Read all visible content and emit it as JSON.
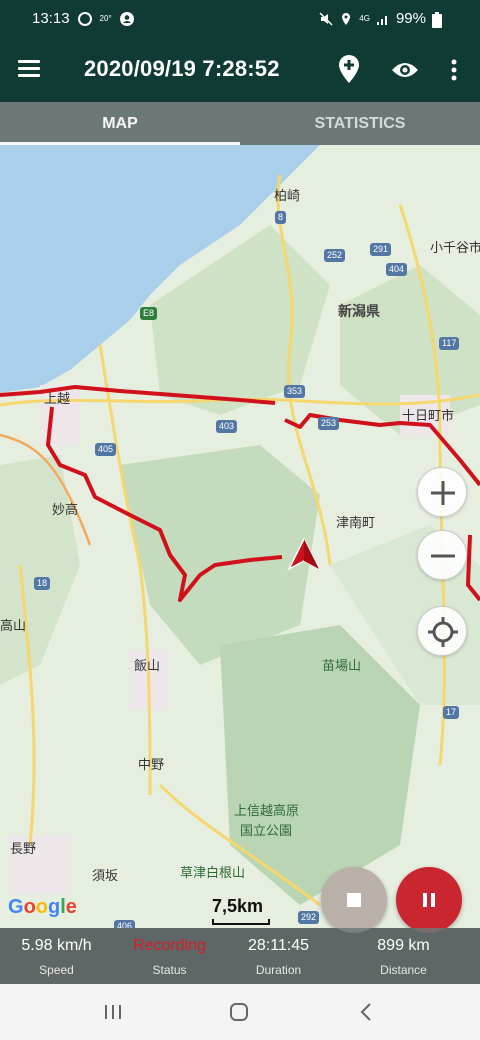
{
  "status_bar": {
    "time": "13:13",
    "battery": "99%",
    "network": "4G",
    "weather_temp": "20°"
  },
  "app_bar": {
    "title": "2020/09/19 7:28:52",
    "icons": [
      "menu-icon",
      "add-marker-icon",
      "visibility-icon",
      "overflow-icon"
    ]
  },
  "tabs": [
    {
      "label": "MAP",
      "selected": true
    },
    {
      "label": "STATISTICS",
      "selected": false
    }
  ],
  "map": {
    "places": [
      "柏崎",
      "小千谷市",
      "新潟県",
      "上越",
      "十日町市",
      "妙高",
      "津南町",
      "高山",
      "飯山",
      "苗場山",
      "中野",
      "上信越高原",
      "国立公園",
      "長野",
      "須坂",
      "草津白根山"
    ],
    "road_numbers": [
      "8",
      "252",
      "291",
      "404",
      "E8",
      "117",
      "353",
      "403",
      "253",
      "405",
      "18",
      "17",
      "406",
      "292"
    ],
    "scale": "7,5km",
    "attribution": "Google",
    "colors": {
      "track": "#d0101b",
      "water": "#a9cfea",
      "land": "#e6eee0",
      "forest": "#c9ddc0"
    }
  },
  "controls": {
    "zoom_in": "zoom-in-icon",
    "zoom_out": "zoom-out-icon",
    "locate": "my-location-icon",
    "stop": "stop-icon",
    "pause": "pause-icon"
  },
  "stats": {
    "speed": {
      "value": "5.98 km/h",
      "label": "Speed"
    },
    "status": {
      "value": "Recording",
      "label": "Status"
    },
    "duration": {
      "value": "28:11:45",
      "label": "Duration"
    },
    "distance": {
      "value": "899 km",
      "label": "Distance"
    }
  },
  "colors": {
    "app_bar": "#0f3b34",
    "recording": "#d81d25",
    "pause_button": "#c9262f",
    "stop_button": "#b9b0a9"
  }
}
